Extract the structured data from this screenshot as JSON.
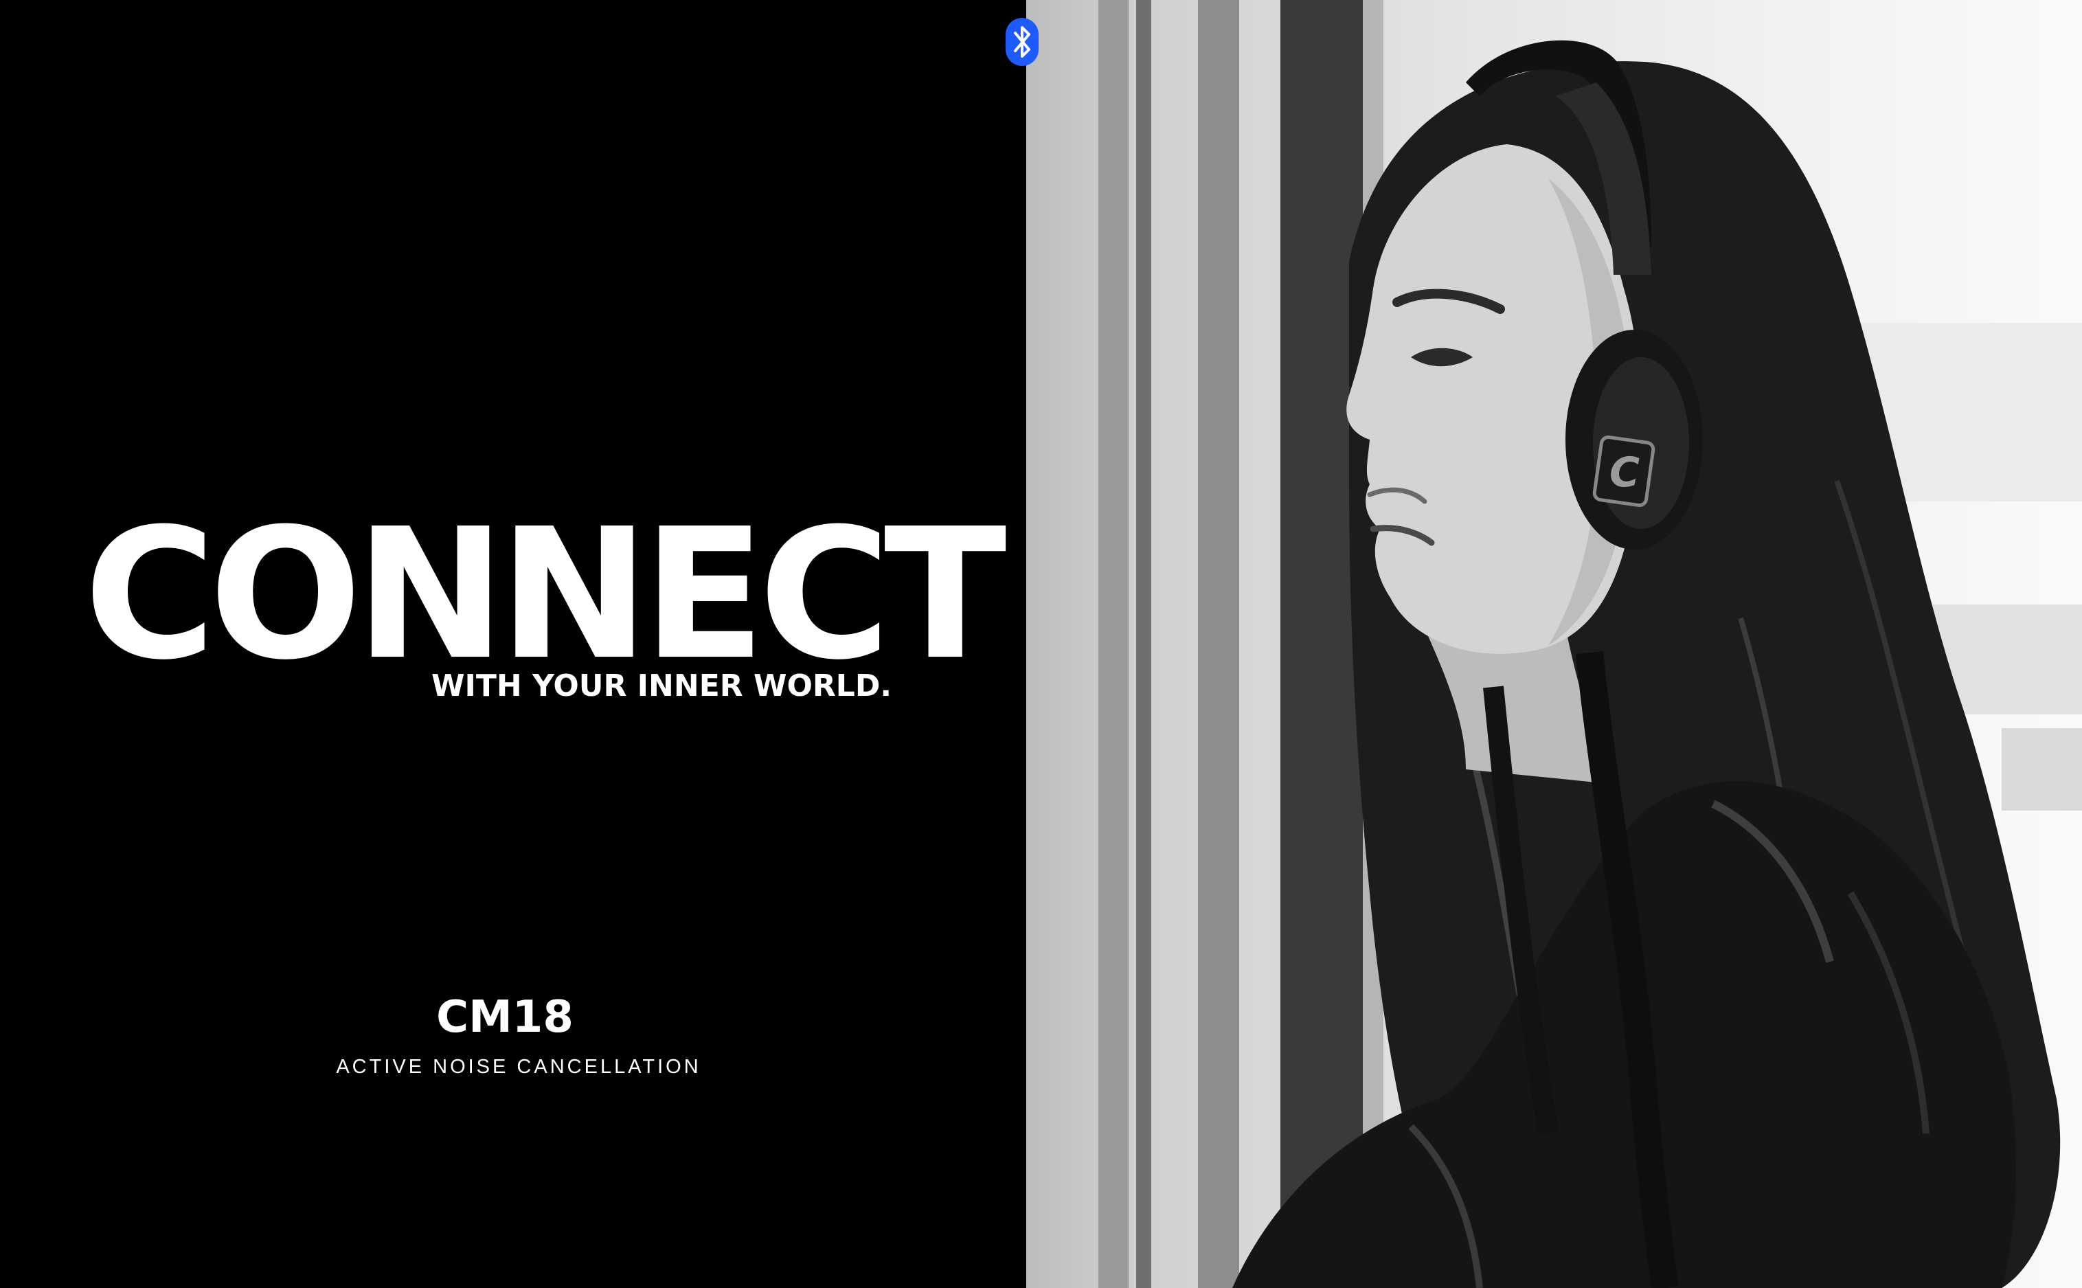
{
  "hero": {
    "headline": "CONNECT",
    "tagline": "WITH YOUR INNER WORLD."
  },
  "product": {
    "model": "CM18",
    "feature": "ACTIVE NOISE CANCELLATION"
  },
  "photo": {
    "headphone_logo_letter": "C"
  },
  "icons": {
    "bluetooth": "bluetooth-icon",
    "logo": "c-logo-icon"
  },
  "colors": {
    "background": "#000000",
    "text": "#ffffff",
    "accent": "#1e5bff"
  }
}
